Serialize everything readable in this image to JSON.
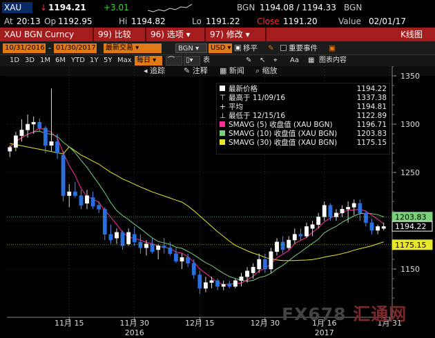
{
  "header": {
    "symbol": "XAU",
    "arrow": "↓",
    "last": "1194.21",
    "change": "+3.01",
    "source": "BGN",
    "bid_ask": "1194.08 / 1194.33",
    "source2": "BGN",
    "at_label": "At",
    "at_time": "20:13",
    "op_label": "Op",
    "op_value": "1192.95",
    "hi_label": "Hi",
    "hi_value": "1194.82",
    "lo_label": "Lo",
    "lo_value": "1191.22",
    "close_label": "Close",
    "close_value": "1191.20",
    "value_label": "Value",
    "value_date": "02/01/17"
  },
  "function_bar": {
    "ticker": "XAU BGN Curncy",
    "compare_num": "99)",
    "compare_label": "比较",
    "options_num": "96)",
    "options_label": "选项",
    "edit_num": "97)",
    "edit_label": "修改",
    "view_title": "K线图"
  },
  "controls": {
    "start_date": "10/31/2016",
    "end_date": "01/30/2017",
    "period": "最新交易",
    "source": "BGN",
    "currency": "USD",
    "move_label": "移平",
    "events_label": "重要事件"
  },
  "toolbar": {
    "ranges": [
      "1D",
      "3D",
      "1M",
      "6M",
      "YTD",
      "1Y",
      "5Y",
      "Max"
    ],
    "frequency": "每日",
    "chart_type": "表",
    "chart_content": "图表内容"
  },
  "actions": {
    "back": "追踪",
    "annotate": "注释",
    "news": "新闻",
    "zoom": "缩放"
  },
  "legend": {
    "last_price_label": "最新价格",
    "last_price": "1194.22",
    "high_label": "最高于 11/09/16",
    "high_value": "1337.38",
    "avg_label": "平均",
    "avg_value": "1194.81",
    "low_label": "最低于 12/15/16",
    "low_value": "1122.89",
    "ma5_label": "SMAVG (5)  收盘值 (XAU BGN)",
    "ma5_value": "1196.71",
    "ma10_label": "SMAVG (10)  收盘值 (XAU BGN)",
    "ma10_value": "1203.83",
    "ma30_label": "SMAVG (30)  收盘值 (XAU BGN)",
    "ma30_value": "1175.15"
  },
  "watermark": {
    "prefix": "FX678",
    "suffix": "汇通网"
  },
  "colors": {
    "candle_up": "#ffffff",
    "candle_down": "#2a6fe0",
    "ma5": "#ff2ea0",
    "ma10": "#7ad17a",
    "ma30": "#e8e82a",
    "function_bar": "#a51c1c",
    "orange": "#e07a16"
  },
  "chart_data": {
    "type": "candlestick",
    "ylim": [
      1100,
      1360
    ],
    "yticks": [
      1150,
      1200,
      1250,
      1300,
      1350
    ],
    "xticks": [
      {
        "label": "11月 15",
        "index": 10
      },
      {
        "label": "11月 30",
        "index": 21
      },
      {
        "label": "12月 15",
        "index": 32
      },
      {
        "label": "12月 30",
        "index": 43
      },
      {
        "label": "1月 16",
        "index": 53
      },
      {
        "label": "1月 31",
        "index": 64
      }
    ],
    "year_labels": [
      {
        "label": "2016",
        "index": 21
      },
      {
        "label": "2017",
        "index": 53
      }
    ],
    "price_tags": [
      {
        "value": 1203.83,
        "label": "1203.83",
        "color": "#7ad17a",
        "text_color": "#000"
      },
      {
        "value": 1194.22,
        "label": "1194.22",
        "color": "#000000",
        "text_color": "#fff"
      },
      {
        "value": 1175.15,
        "label": "1175.15",
        "color": "#e8e82a",
        "text_color": "#000"
      }
    ],
    "candles": [
      {
        "o": 1272,
        "h": 1278,
        "l": 1266,
        "c": 1276
      },
      {
        "o": 1276,
        "h": 1292,
        "l": 1272,
        "c": 1288
      },
      {
        "o": 1288,
        "h": 1305,
        "l": 1282,
        "c": 1294
      },
      {
        "o": 1294,
        "h": 1310,
        "l": 1286,
        "c": 1300
      },
      {
        "o": 1300,
        "h": 1308,
        "l": 1290,
        "c": 1302
      },
      {
        "o": 1302,
        "h": 1306,
        "l": 1292,
        "c": 1296
      },
      {
        "o": 1296,
        "h": 1298,
        "l": 1270,
        "c": 1278
      },
      {
        "o": 1278,
        "h": 1337,
        "l": 1272,
        "c": 1282
      },
      {
        "o": 1282,
        "h": 1290,
        "l": 1264,
        "c": 1270
      },
      {
        "o": 1268,
        "h": 1272,
        "l": 1220,
        "c": 1226
      },
      {
        "o": 1226,
        "h": 1238,
        "l": 1214,
        "c": 1230
      },
      {
        "o": 1230,
        "h": 1240,
        "l": 1224,
        "c": 1226
      },
      {
        "o": 1226,
        "h": 1232,
        "l": 1212,
        "c": 1216
      },
      {
        "o": 1218,
        "h": 1232,
        "l": 1212,
        "c": 1226
      },
      {
        "o": 1224,
        "h": 1230,
        "l": 1212,
        "c": 1215
      },
      {
        "o": 1216,
        "h": 1220,
        "l": 1208,
        "c": 1212
      },
      {
        "o": 1212,
        "h": 1214,
        "l": 1180,
        "c": 1186
      },
      {
        "o": 1186,
        "h": 1196,
        "l": 1176,
        "c": 1180
      },
      {
        "o": 1182,
        "h": 1192,
        "l": 1176,
        "c": 1188
      },
      {
        "o": 1188,
        "h": 1190,
        "l": 1170,
        "c": 1174
      },
      {
        "o": 1176,
        "h": 1192,
        "l": 1174,
        "c": 1188
      },
      {
        "o": 1186,
        "h": 1194,
        "l": 1174,
        "c": 1178
      },
      {
        "o": 1178,
        "h": 1186,
        "l": 1166,
        "c": 1172
      },
      {
        "o": 1172,
        "h": 1180,
        "l": 1164,
        "c": 1176
      },
      {
        "o": 1176,
        "h": 1182,
        "l": 1166,
        "c": 1168
      },
      {
        "o": 1170,
        "h": 1176,
        "l": 1160,
        "c": 1174
      },
      {
        "o": 1174,
        "h": 1182,
        "l": 1166,
        "c": 1172
      },
      {
        "o": 1172,
        "h": 1178,
        "l": 1164,
        "c": 1166
      },
      {
        "o": 1166,
        "h": 1172,
        "l": 1156,
        "c": 1158
      },
      {
        "o": 1158,
        "h": 1166,
        "l": 1150,
        "c": 1162
      },
      {
        "o": 1162,
        "h": 1166,
        "l": 1152,
        "c": 1156
      },
      {
        "o": 1156,
        "h": 1160,
        "l": 1140,
        "c": 1144
      },
      {
        "o": 1144,
        "h": 1148,
        "l": 1124,
        "c": 1130
      },
      {
        "o": 1130,
        "h": 1142,
        "l": 1126,
        "c": 1136
      },
      {
        "o": 1136,
        "h": 1142,
        "l": 1130,
        "c": 1138
      },
      {
        "o": 1138,
        "h": 1140,
        "l": 1128,
        "c": 1132
      },
      {
        "o": 1132,
        "h": 1138,
        "l": 1128,
        "c": 1134
      },
      {
        "o": 1134,
        "h": 1138,
        "l": 1130,
        "c": 1132
      },
      {
        "o": 1132,
        "h": 1140,
        "l": 1130,
        "c": 1138
      },
      {
        "o": 1138,
        "h": 1146,
        "l": 1132,
        "c": 1142
      },
      {
        "o": 1142,
        "h": 1152,
        "l": 1136,
        "c": 1148
      },
      {
        "o": 1146,
        "h": 1156,
        "l": 1140,
        "c": 1152
      },
      {
        "o": 1150,
        "h": 1166,
        "l": 1146,
        "c": 1160
      },
      {
        "o": 1160,
        "h": 1166,
        "l": 1146,
        "c": 1150
      },
      {
        "o": 1150,
        "h": 1172,
        "l": 1146,
        "c": 1168
      },
      {
        "o": 1168,
        "h": 1182,
        "l": 1164,
        "c": 1178
      },
      {
        "o": 1178,
        "h": 1184,
        "l": 1166,
        "c": 1170
      },
      {
        "o": 1172,
        "h": 1184,
        "l": 1170,
        "c": 1180
      },
      {
        "o": 1180,
        "h": 1192,
        "l": 1176,
        "c": 1186
      },
      {
        "o": 1186,
        "h": 1192,
        "l": 1180,
        "c": 1184
      },
      {
        "o": 1184,
        "h": 1198,
        "l": 1182,
        "c": 1194
      },
      {
        "o": 1192,
        "h": 1200,
        "l": 1184,
        "c": 1196
      },
      {
        "o": 1196,
        "h": 1208,
        "l": 1192,
        "c": 1204
      },
      {
        "o": 1204,
        "h": 1220,
        "l": 1200,
        "c": 1216
      },
      {
        "o": 1216,
        "h": 1218,
        "l": 1200,
        "c": 1204
      },
      {
        "o": 1204,
        "h": 1212,
        "l": 1200,
        "c": 1208
      },
      {
        "o": 1208,
        "h": 1216,
        "l": 1204,
        "c": 1212
      },
      {
        "o": 1212,
        "h": 1220,
        "l": 1198,
        "c": 1214
      },
      {
        "o": 1214,
        "h": 1222,
        "l": 1206,
        "c": 1218
      },
      {
        "o": 1218,
        "h": 1222,
        "l": 1200,
        "c": 1208
      },
      {
        "o": 1208,
        "h": 1210,
        "l": 1194,
        "c": 1198
      },
      {
        "o": 1198,
        "h": 1202,
        "l": 1186,
        "c": 1190
      },
      {
        "o": 1190,
        "h": 1196,
        "l": 1186,
        "c": 1194
      },
      {
        "o": 1192,
        "h": 1198,
        "l": 1190,
        "c": 1194
      }
    ]
  }
}
